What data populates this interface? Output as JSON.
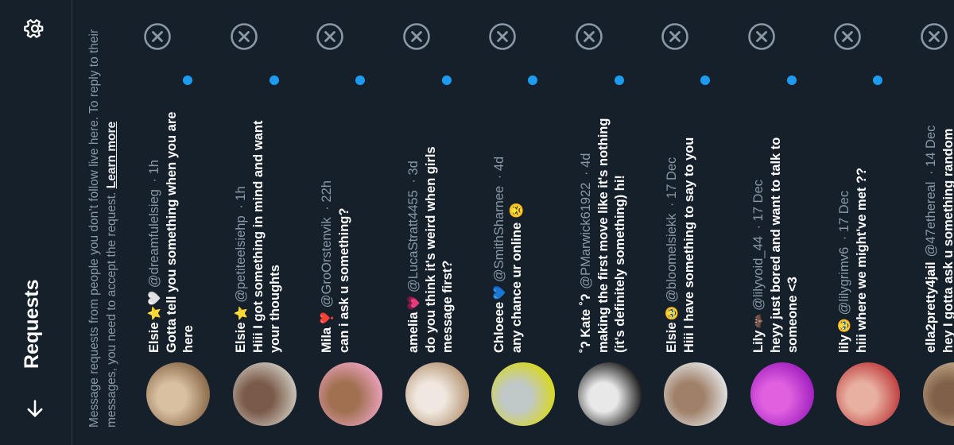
{
  "header": {
    "title": "Requests"
  },
  "info": {
    "text": "Message requests from people you don’t follow live here. To reply to their messages, you need to accept the request.",
    "learn_more": "Learn more"
  },
  "colors": {
    "background": "#15202b",
    "unread_dot": "#1d9bf0",
    "text_secondary": "#8b98a5"
  },
  "icons": {
    "back": "arrow-left-icon",
    "settings": "gear-icon",
    "dismiss": "close-circle-icon"
  },
  "requests": [
    {
      "name": "Elsie",
      "emoji": "⭐🤍",
      "handle": "@dreamfulelsieg",
      "time": "· 1h",
      "message": "Gotta tell you something when you are here",
      "avatar_colors": [
        "#8a6a4a",
        "#d8c0a0"
      ]
    },
    {
      "name": "Elsie",
      "emoji": "⭐",
      "handle": "@petiteelsiehp",
      "time": "· 1h",
      "message": "Hiii I got something in mind and want your thoughts",
      "avatar_colors": [
        "#c9c2b8",
        "#7a5a48"
      ]
    },
    {
      "name": "Mila",
      "emoji": "❣️",
      "handle": "@GroOrstenvik",
      "time": "· 22h",
      "message": "can i ask u something?",
      "avatar_colors": [
        "#e8a0b8",
        "#a07050"
      ]
    },
    {
      "name": "amelia",
      "emoji": "💗",
      "handle": "@LucaStratt4455",
      "time": "· 3d",
      "message": "do you think it's weird when girls message first?",
      "avatar_colors": [
        "#b89878",
        "#f0e8e0"
      ]
    },
    {
      "name": "Chloeee",
      "emoji": "💙",
      "handle": "@SmithSharnee",
      "time": "· 4d",
      "message": "any chance ur online 😣",
      "avatar_colors": [
        "#d8d820",
        "#c0c8c8"
      ]
    },
    {
      "name": "˚ʔ Kate ˚ʔ",
      "emoji": "",
      "handle": "@PMarwick61922",
      "time": "· 4d",
      "message": "making the first move like it's nothing (it's definitely something) hi!",
      "avatar_colors": [
        "#202020",
        "#e8e8e8"
      ]
    },
    {
      "name": "Elsie",
      "emoji": "🥹",
      "handle": "@bloomelsiekk",
      "time": "· 17 Dec",
      "message": "Hiii I have something to say to you",
      "avatar_colors": [
        "#e0e0e0",
        "#a08068"
      ]
    },
    {
      "name": "Lily",
      "emoji": "🦇",
      "handle": "@lilyvoid_44",
      "time": "· 17 Dec",
      "message": "heyy just bored and want to talk to someone <3",
      "avatar_colors": [
        "#a020c0",
        "#e060e0"
      ]
    },
    {
      "name": "lily",
      "emoji": "🥹",
      "handle": "@lilygrimv6",
      "time": "· 17 Dec",
      "message": "hiii where we might've met ??",
      "avatar_colors": [
        "#c04040",
        "#e8b0a0"
      ]
    },
    {
      "name": "ella2pretty4jail",
      "emoji": "",
      "handle": "@47ethereal",
      "time": "· 14 Dec",
      "message": "hey I gotta ask u something random",
      "avatar_colors": [
        "#c0a888",
        "#806048"
      ]
    }
  ]
}
